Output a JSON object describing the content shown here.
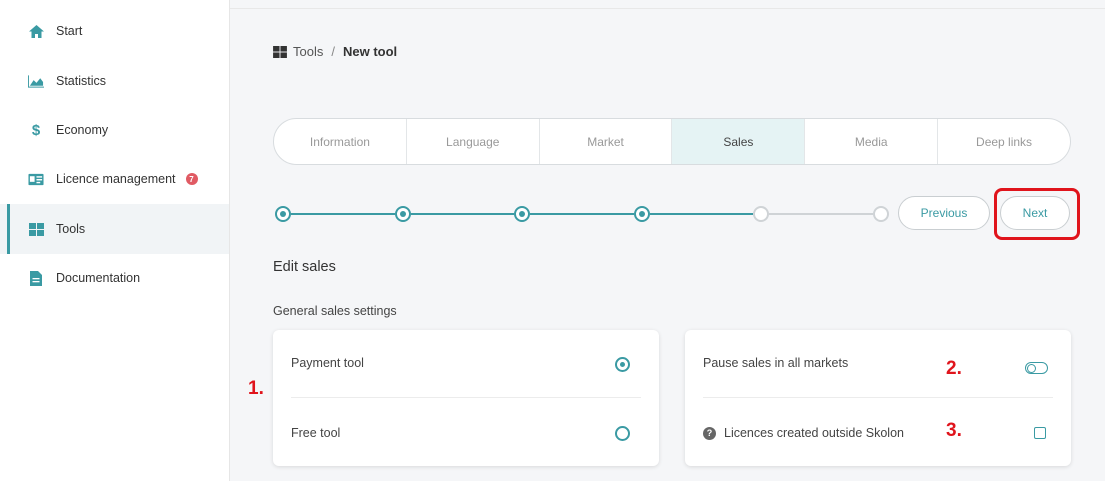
{
  "sidebar": {
    "items": [
      {
        "label": "Start",
        "icon": "home-icon"
      },
      {
        "label": "Statistics",
        "icon": "area-chart-icon"
      },
      {
        "label": "Economy",
        "icon": "dollar-icon"
      },
      {
        "label": "Licence management",
        "icon": "id-card-icon",
        "badge": "7"
      },
      {
        "label": "Tools",
        "icon": "grid-icon",
        "active": true
      },
      {
        "label": "Documentation",
        "icon": "document-icon"
      }
    ]
  },
  "breadcrumb": {
    "parent": "Tools",
    "separator": "/",
    "current": "New tool"
  },
  "tabs": [
    {
      "label": "Information"
    },
    {
      "label": "Language"
    },
    {
      "label": "Market"
    },
    {
      "label": "Sales",
      "active": true
    },
    {
      "label": "Media"
    },
    {
      "label": "Deep links"
    }
  ],
  "stepper": {
    "total_steps": 6,
    "completed_steps": 4
  },
  "buttons": {
    "previous": "Previous",
    "next": "Next"
  },
  "section": {
    "title": "Edit sales",
    "subtitle": "General sales settings"
  },
  "pricing_card": {
    "payment_label": "Payment tool",
    "free_label": "Free tool",
    "selected": "Payment tool"
  },
  "options_card": {
    "pause_label": "Pause sales in all markets",
    "pause_enabled": false,
    "licences_label": "Licences created outside Skolon",
    "licences_checked": false
  },
  "annotations": {
    "one": "1.",
    "two": "2.",
    "three": "3."
  },
  "colors": {
    "accent": "#3a9aa3",
    "annotation": "#e0141c",
    "badge": "#e05a63"
  }
}
